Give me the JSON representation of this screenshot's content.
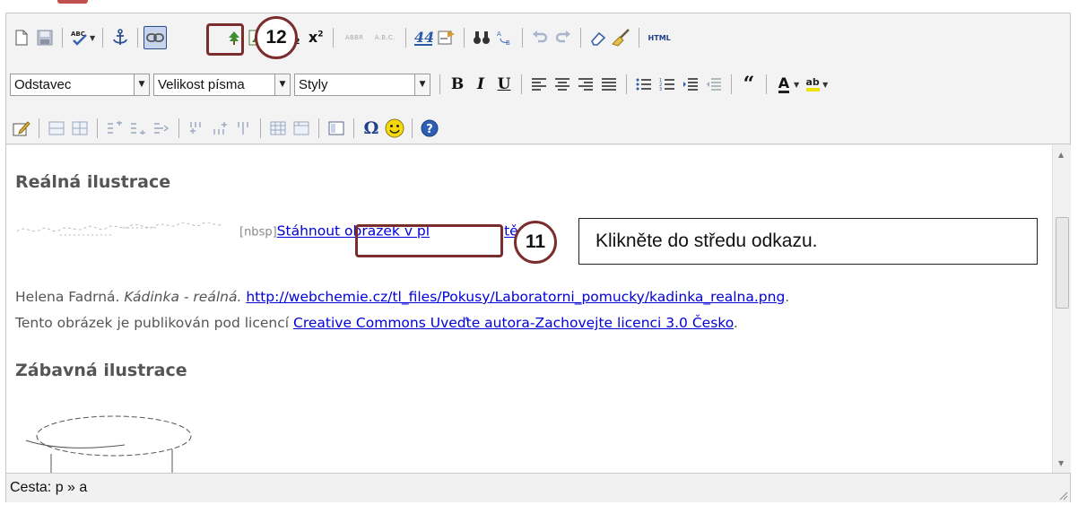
{
  "toolbar": {
    "row2": {
      "format_select": "Odstavec",
      "size_select": "Velikost písma",
      "styles_select": "Styly",
      "bold": "B",
      "italic": "I",
      "underline": "U",
      "quote": "“",
      "font_color": "A",
      "highlight": "ab"
    },
    "row1": {
      "subscript": "x",
      "superscript": "x",
      "abbr": "ABBR",
      "acronym": "A.B.C.",
      "html": "HTML"
    },
    "row3": {
      "omega": "Ω"
    }
  },
  "content": {
    "heading1": "Reálná ilustrace",
    "nbsp_tag": "[nbsp]",
    "link_text": "Stáhnout obrázek v pl",
    "link_tail": "tě",
    "credit_author": "Helena Fadrná.",
    "credit_title": "Kádinka - reálná.",
    "credit_url": "http://webchemie.cz/tl_files/Pokusy/Laboratorni_pomucky/kadinka_realna.png",
    "credit_period": ".",
    "license_prefix": "Tento obrázek je publikován pod licencí",
    "license_link": "Creative Commons Uveďte autora-Zachovejte licenci 3.0 Česko",
    "license_period": ".",
    "heading2": "Zábavná ilustrace"
  },
  "statusbar": {
    "path": "Cesta: p » a"
  },
  "annotations": {
    "step12": "12",
    "step11": "11",
    "callout": "Klikněte do středu odkazu."
  },
  "colors": {
    "annotation": "#7a2d2d",
    "link": "#0000d8",
    "active_button": "#c7d4ec"
  }
}
